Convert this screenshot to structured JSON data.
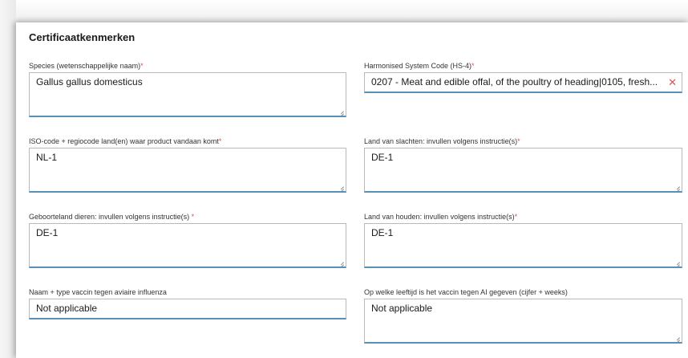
{
  "section": {
    "title": "Certificaatkenmerken"
  },
  "fields": [
    {
      "label": "Species (wetenschappelijke naam)",
      "required": "*",
      "value": "Gallus gallus domesticus"
    },
    {
      "label": "Harmonised System Code (HS-4)",
      "required": "*",
      "value": "0207 - Meat and edible offal, of the poultry of heading|0105, fresh...",
      "clear_icon": "✕"
    },
    {
      "label": "ISO-code + regiocode land(en) waar product vandaan komt",
      "required": "*",
      "value": "NL-1"
    },
    {
      "label": "Land van slachten: invullen volgens instructie(s)",
      "required": "*",
      "value": "DE-1"
    },
    {
      "label": "Geboorteland dieren: invullen volgens instructie(s) ",
      "required": "*",
      "value": "DE-1"
    },
    {
      "label": "Land van houden: invullen volgens instructie(s)",
      "required": "*",
      "value": "DE-1"
    },
    {
      "label": "Naam + type vaccin tegen aviaire influenza",
      "required": "",
      "value": "Not applicable"
    },
    {
      "label": "Op welke leeftijd is het vaccin tegen AI gegeven (cijfer + weeks)",
      "required": "",
      "value": "Not applicable"
    }
  ],
  "colors": {
    "required": "#d9534f",
    "focus_border": "#5a8fb8"
  }
}
